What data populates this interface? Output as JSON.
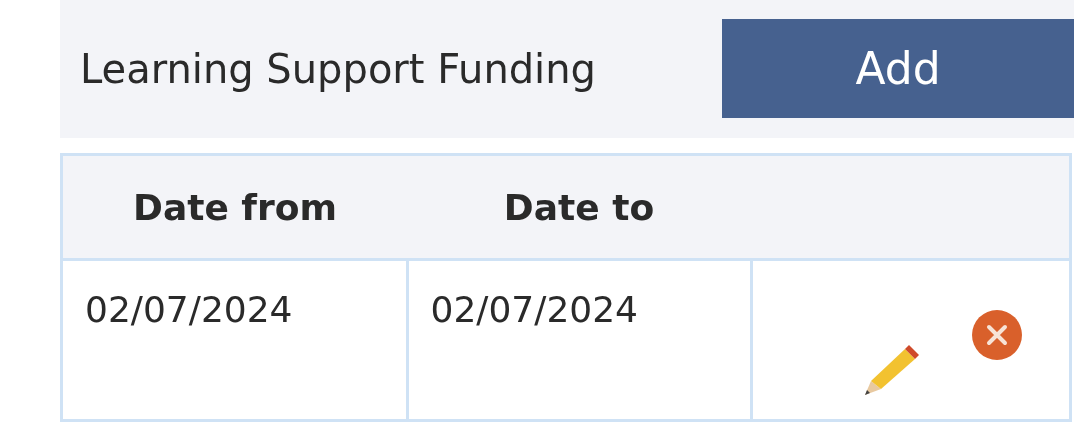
{
  "header": {
    "title": "Learning Support Funding",
    "add_button": "Add"
  },
  "table": {
    "columns": [
      "Date from",
      "Date to"
    ],
    "rows": [
      {
        "date_from": "02/07/2024",
        "date_to": "02/07/2024"
      }
    ]
  }
}
